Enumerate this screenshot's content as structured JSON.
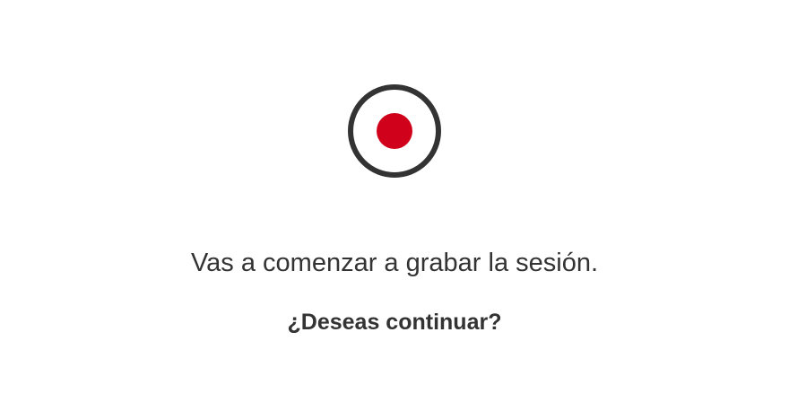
{
  "dialog": {
    "icon": "record-icon",
    "icon_ring_color": "#333333",
    "icon_dot_color": "#d0021b",
    "message": "Vas a comenzar a grabar la sesión.",
    "question": "¿Deseas continuar?"
  }
}
